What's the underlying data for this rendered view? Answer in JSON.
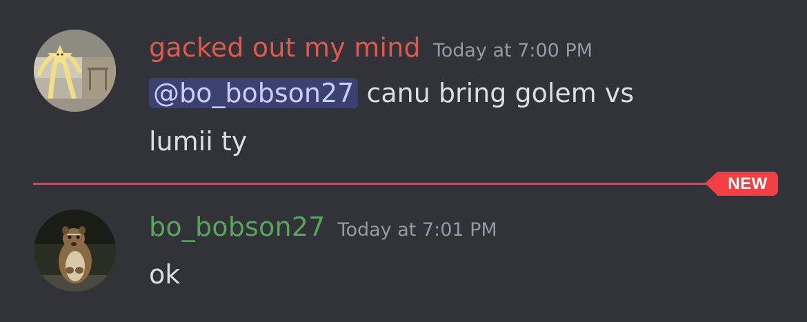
{
  "messages": [
    {
      "author": "gacked out my mind",
      "author_color": "#e2584b",
      "timestamp": "Today at 7:00 PM",
      "mention": "@bo_bobson27",
      "text_line1": " canu bring golem vs",
      "text_line2": "lumii ty",
      "avatar": "plush-toy-avatar"
    },
    {
      "author": "bo_bobson27",
      "author_color": "#57a65b",
      "timestamp": "Today at 7:01 PM",
      "text": "ok",
      "avatar": "chipmunk-avatar"
    }
  ],
  "divider": {
    "label": "NEW",
    "color": "#f23f43"
  }
}
